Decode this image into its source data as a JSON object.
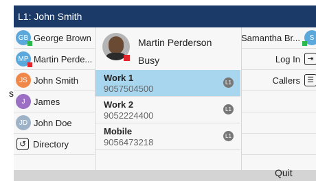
{
  "edge_text": "s",
  "title": "L1: John Smith",
  "favorites": [
    {
      "initials": "GB",
      "name": "George Brown",
      "color": "#5ba9dc",
      "presence": "#2db84d"
    },
    {
      "initials": "MP",
      "name": "Martin Perde...",
      "color": "#5ba9dc",
      "presence": "#e2262b"
    },
    {
      "initials": "JS",
      "name": "John Smith",
      "color": "#f0884a",
      "presence": ""
    },
    {
      "initials": "J",
      "name": "James",
      "color": "#9b6fc4",
      "presence": ""
    },
    {
      "initials": "JD",
      "name": "John Doe",
      "color": "#9fb3c8",
      "presence": ""
    }
  ],
  "directory_label": "Directory",
  "contact": {
    "name": "Martin Perderson",
    "status": "Busy",
    "presence_color": "#e2262b"
  },
  "numbers": [
    {
      "label": "Work 1",
      "number": "9057504500",
      "line": "L1",
      "selected": true
    },
    {
      "label": "Work 2",
      "number": "9052224400",
      "line": "L1",
      "selected": false
    },
    {
      "label": "Mobile",
      "number": "9056473218",
      "line": "L1",
      "selected": false
    }
  ],
  "right": {
    "contact_name": "Samantha Br...",
    "contact_initials": "S",
    "contact_color": "#5ba9dc",
    "contact_presence": "#2db84d",
    "login_label": "Log In",
    "callers_label": "Callers"
  },
  "softkey": "Quit"
}
